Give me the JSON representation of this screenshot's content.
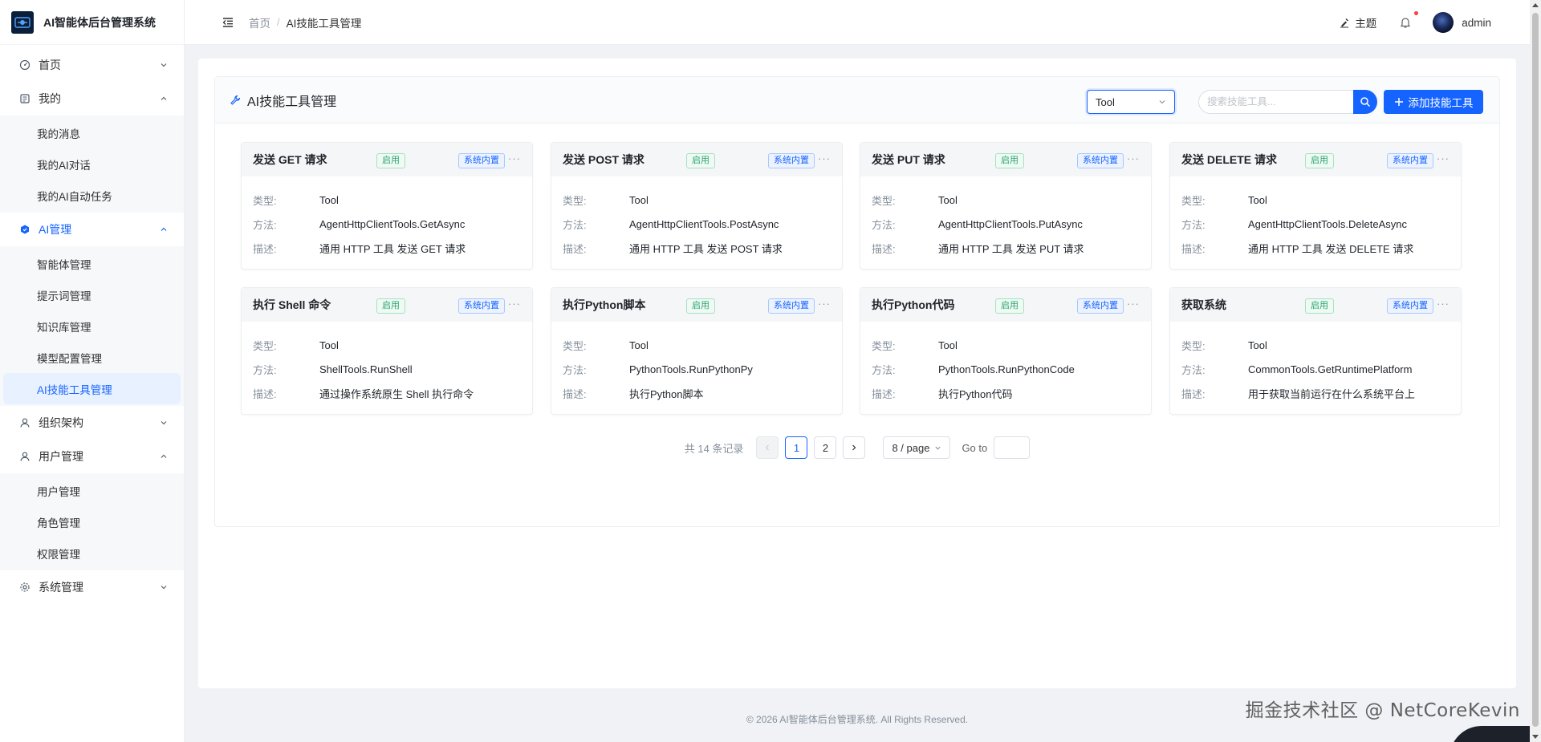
{
  "app": {
    "title": "AI智能体后台管理系统"
  },
  "sidebar": {
    "groups": [
      {
        "label": "首页",
        "icon": "dashboard-icon",
        "expanded": false,
        "items": []
      },
      {
        "label": "我的",
        "icon": "profile-icon",
        "expanded": true,
        "items": [
          "我的消息",
          "我的AI对话",
          "我的AI自动任务"
        ]
      },
      {
        "label": "AI管理",
        "icon": "ai-icon",
        "expanded": true,
        "active": true,
        "items": [
          "智能体管理",
          "提示词管理",
          "知识库管理",
          "模型配置管理",
          "AI技能工具管理"
        ]
      },
      {
        "label": "组织架构",
        "icon": "user-icon",
        "expanded": false,
        "items": []
      },
      {
        "label": "用户管理",
        "icon": "user-icon",
        "expanded": true,
        "items": [
          "用户管理",
          "角色管理",
          "权限管理"
        ]
      },
      {
        "label": "系统管理",
        "icon": "settings-icon",
        "expanded": false,
        "items": []
      }
    ],
    "active_item": "AI技能工具管理"
  },
  "header": {
    "breadcrumb_home": "首页",
    "breadcrumb_sep": "/",
    "breadcrumb_current": "AI技能工具管理",
    "theme_label": "主题",
    "username": "admin"
  },
  "panel": {
    "title": "AI技能工具管理",
    "type_filter": "Tool",
    "search_placeholder": "搜索技能工具...",
    "add_label": "添加技能工具"
  },
  "labels": {
    "type": "类型:",
    "method": "方法:",
    "desc": "描述:"
  },
  "cards": [
    {
      "title": "发送 GET 请求",
      "status": "启用",
      "badge": "系统内置",
      "more": "···",
      "type": "Tool",
      "method": "AgentHttpClientTools.GetAsync",
      "desc": "通用 HTTP 工具 发送 GET 请求"
    },
    {
      "title": "发送 POST 请求",
      "status": "启用",
      "badge": "系统内置",
      "more": "···",
      "type": "Tool",
      "method": "AgentHttpClientTools.PostAsync",
      "desc": "通用 HTTP 工具 发送 POST 请求"
    },
    {
      "title": "发送 PUT 请求",
      "status": "启用",
      "badge": "系统内置",
      "more": "···",
      "type": "Tool",
      "method": "AgentHttpClientTools.PutAsync",
      "desc": "通用 HTTP 工具 发送 PUT 请求"
    },
    {
      "title": "发送 DELETE 请求",
      "status": "启用",
      "badge": "系统内置",
      "more": "···",
      "type": "Tool",
      "method": "AgentHttpClientTools.DeleteAsync",
      "desc": "通用 HTTP 工具 发送 DELETE 请求"
    },
    {
      "title": "执行 Shell 命令",
      "status": "启用",
      "badge": "系统内置",
      "more": "···",
      "type": "Tool",
      "method": "ShellTools.RunShell",
      "desc": "通过操作系统原生 Shell 执行命令"
    },
    {
      "title": "执行Python脚本",
      "status": "启用",
      "badge": "系统内置",
      "more": "···",
      "type": "Tool",
      "method": "PythonTools.RunPythonPy",
      "desc": "执行Python脚本"
    },
    {
      "title": "执行Python代码",
      "status": "启用",
      "badge": "系统内置",
      "more": "···",
      "type": "Tool",
      "method": "PythonTools.RunPythonCode",
      "desc": "执行Python代码"
    },
    {
      "title": "获取系统",
      "status": "启用",
      "badge": "系统内置",
      "more": "···",
      "type": "Tool",
      "method": "CommonTools.GetRuntimePlatform",
      "desc": "用于获取当前运行在什么系统平台上"
    }
  ],
  "pagination": {
    "total_text": "共 14 条记录",
    "pages": [
      "1",
      "2"
    ],
    "current_page": "1",
    "page_size": "8 / page",
    "goto_label": "Go to"
  },
  "footer": {
    "text": "© 2026 AI智能体后台管理系统. All Rights Reserved."
  },
  "watermark": {
    "text": "掘金技术社区 @ NetCoreKevin"
  },
  "colors": {
    "primary": "#1664ff",
    "success": "#2ba471",
    "sidebar_bg": "#ffffff",
    "page_bg": "#f0f2f5"
  }
}
